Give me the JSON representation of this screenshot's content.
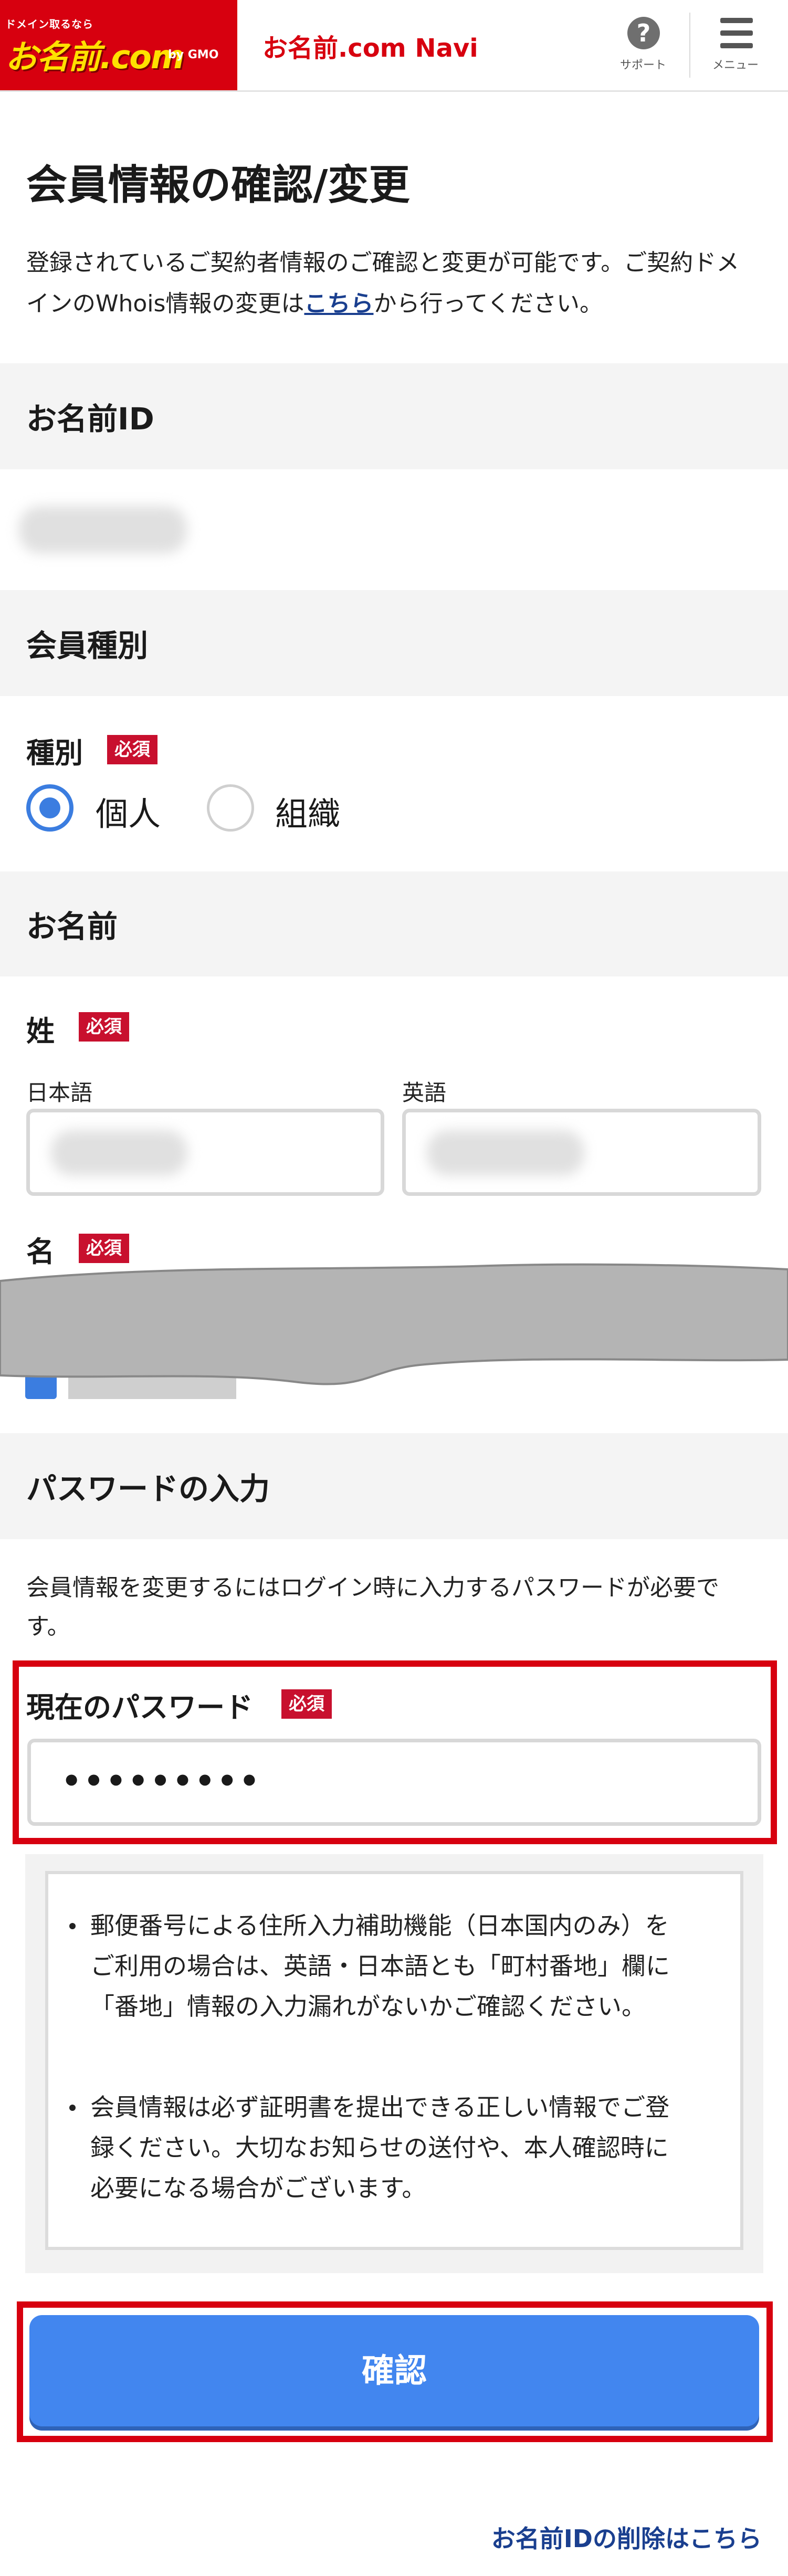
{
  "header": {
    "logo_tagline": "ドメイン取るなら",
    "logo_text": "お名前.com",
    "logo_gmo": "by GMO",
    "title": "お名前.com Navi",
    "support_label": "サポート",
    "menu_label": "メニュー"
  },
  "page": {
    "title": "会員情報の確認/変更",
    "intro_before": "登録されているご契約者情報のご確認と変更が可能です。ご契約ドメインのWhois情報の変更は",
    "intro_link": "こちら",
    "intro_after": "から行ってください。"
  },
  "sections": {
    "id_title": "お名前ID",
    "type_title": "会員種別",
    "name_title": "お名前",
    "password_title": "パスワードの入力"
  },
  "member_type": {
    "label": "種別",
    "required": "必須",
    "options": [
      "個人",
      "組織"
    ],
    "selected": "個人"
  },
  "name": {
    "last_label": "姓",
    "first_label": "名",
    "required": "必須",
    "japanese_label": "日本語",
    "english_label": "英語"
  },
  "password": {
    "description": "会員情報を変更するにはログイン時に入力するパスワードが必要です。",
    "label": "現在のパスワード",
    "required": "必須",
    "value": "•••••••••"
  },
  "notices": [
    "郵便番号による住所入力補助機能（日本国内のみ）をご利用の場合は、英語・日本語とも「町村番地」欄に「番地」情報の入力漏れがないかご確認ください。",
    "会員情報は必ず証明書を提出できる正しい情報でご登録ください。大切なお知らせの送付や、本人確認時に必要になる場合がございます。"
  ],
  "actions": {
    "confirm_label": "確認",
    "delete_link": "お名前IDの削除はこちら"
  },
  "colors": {
    "brand_red": "#d7000f",
    "button_blue": "#4286ef",
    "link_navy": "#1a3f8f",
    "required_red": "#c8102e"
  }
}
